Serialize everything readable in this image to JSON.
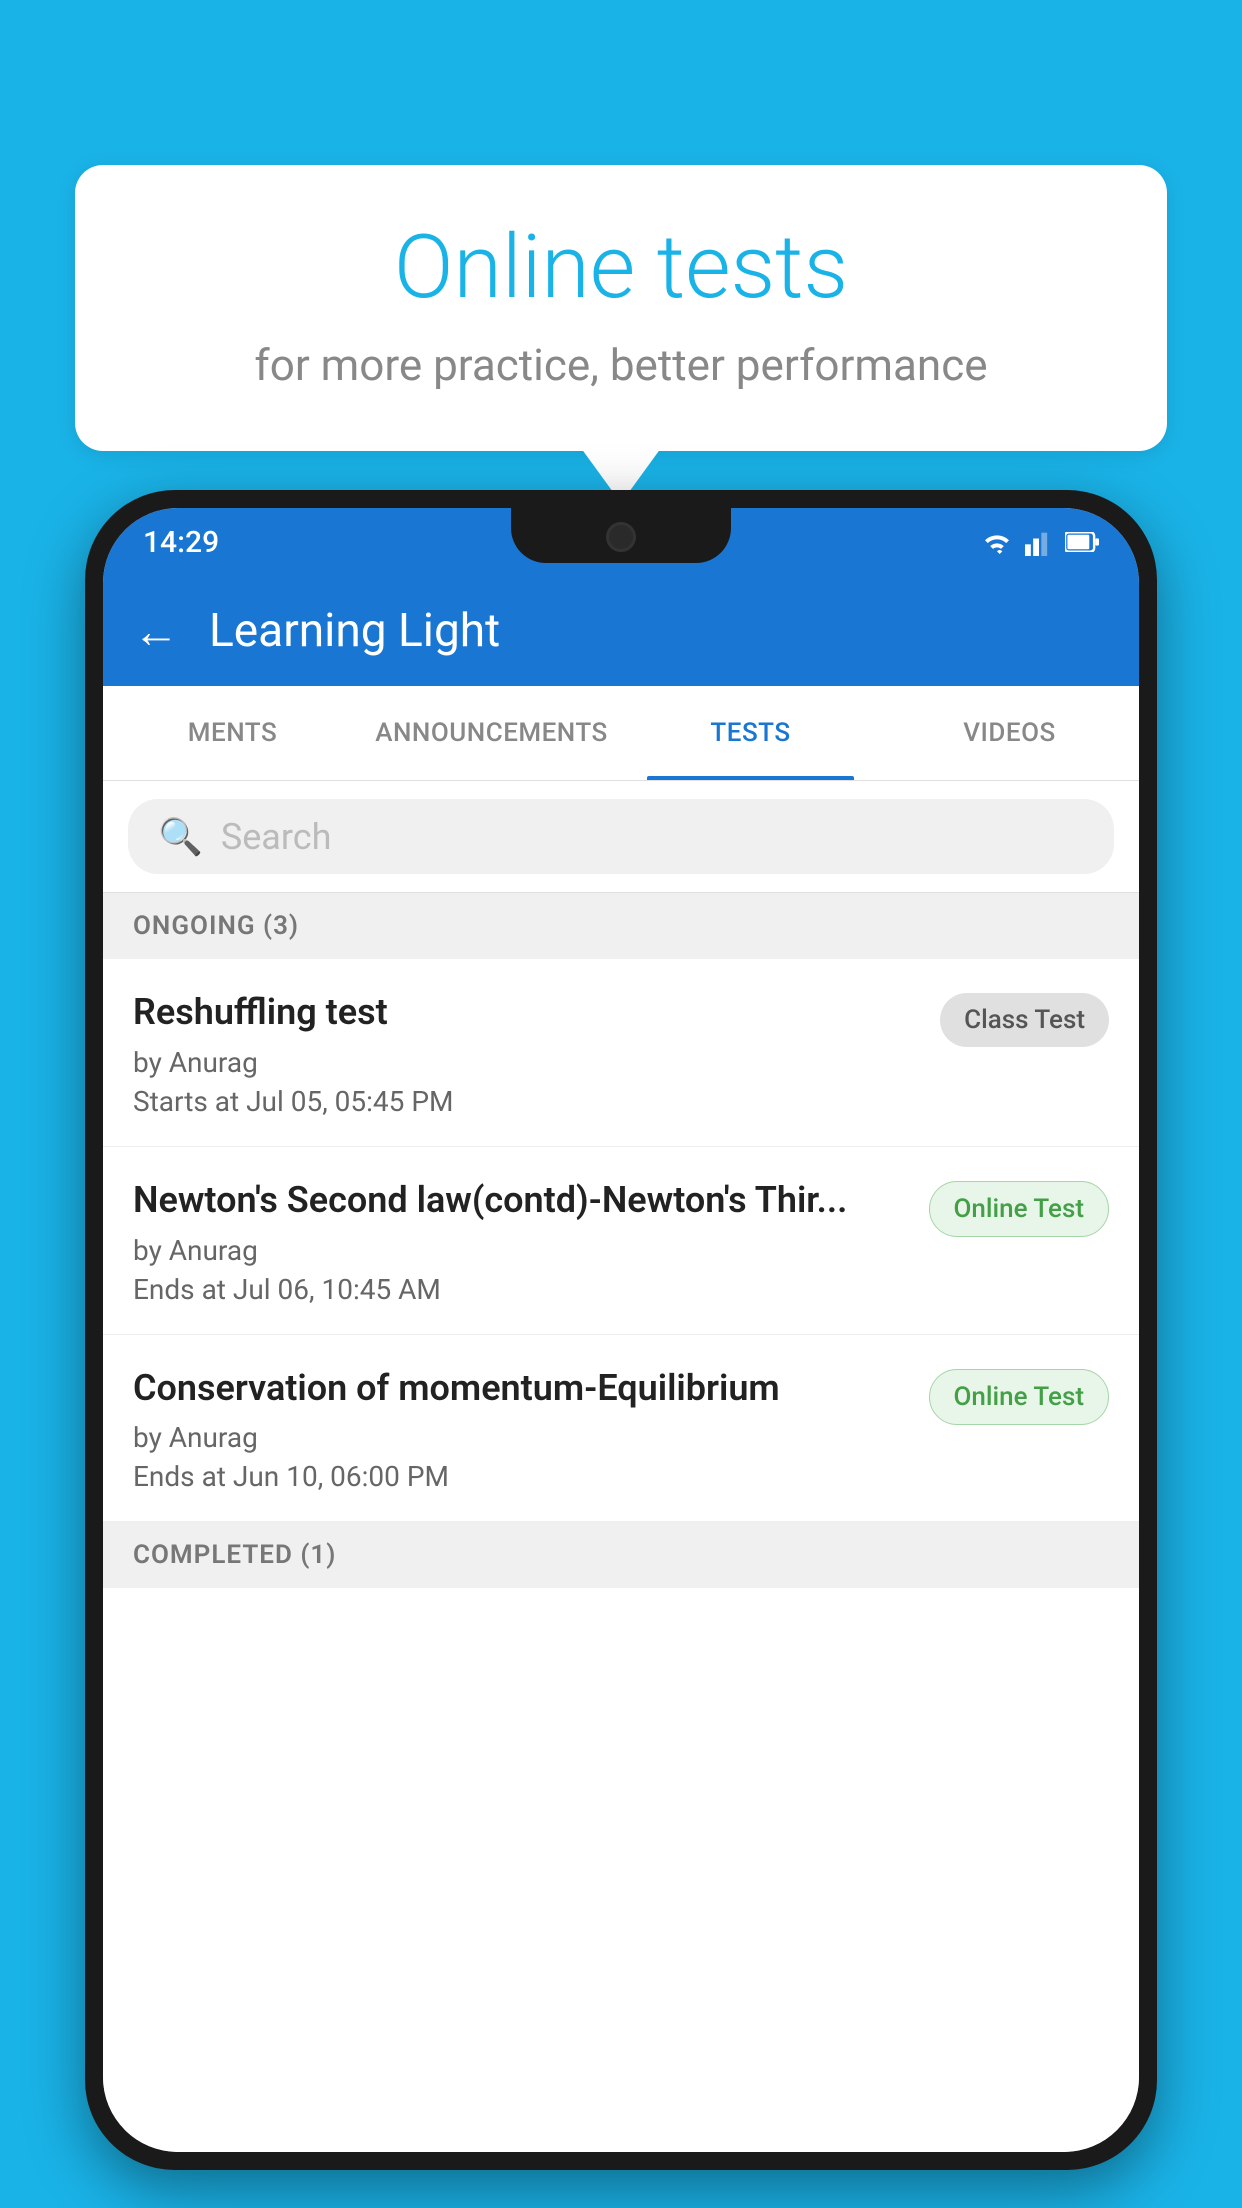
{
  "background_color": "#1ab3e8",
  "speech_bubble": {
    "title": "Online tests",
    "subtitle": "for more practice, better performance"
  },
  "phone": {
    "status_bar": {
      "time": "14:29",
      "icons": [
        "wifi",
        "signal",
        "battery"
      ]
    },
    "app_bar": {
      "title": "Learning Light",
      "back_label": "←"
    },
    "tabs": [
      {
        "label": "MENTS",
        "active": false
      },
      {
        "label": "ANNOUNCEMENTS",
        "active": false
      },
      {
        "label": "TESTS",
        "active": true
      },
      {
        "label": "VIDEOS",
        "active": false
      }
    ],
    "search": {
      "placeholder": "Search"
    },
    "section_ongoing": {
      "label": "ONGOING (3)"
    },
    "tests_ongoing": [
      {
        "name": "Reshuffling test",
        "author": "by Anurag",
        "time_label": "Starts at",
        "time_value": "Jul 05, 05:45 PM",
        "badge": "Class Test",
        "badge_type": "class"
      },
      {
        "name": "Newton's Second law(contd)-Newton's Thir...",
        "author": "by Anurag",
        "time_label": "Ends at",
        "time_value": "Jul 06, 10:45 AM",
        "badge": "Online Test",
        "badge_type": "online"
      },
      {
        "name": "Conservation of momentum-Equilibrium",
        "author": "by Anurag",
        "time_label": "Ends at",
        "time_value": "Jun 10, 06:00 PM",
        "badge": "Online Test",
        "badge_type": "online"
      }
    ],
    "section_completed": {
      "label": "COMPLETED (1)"
    }
  }
}
